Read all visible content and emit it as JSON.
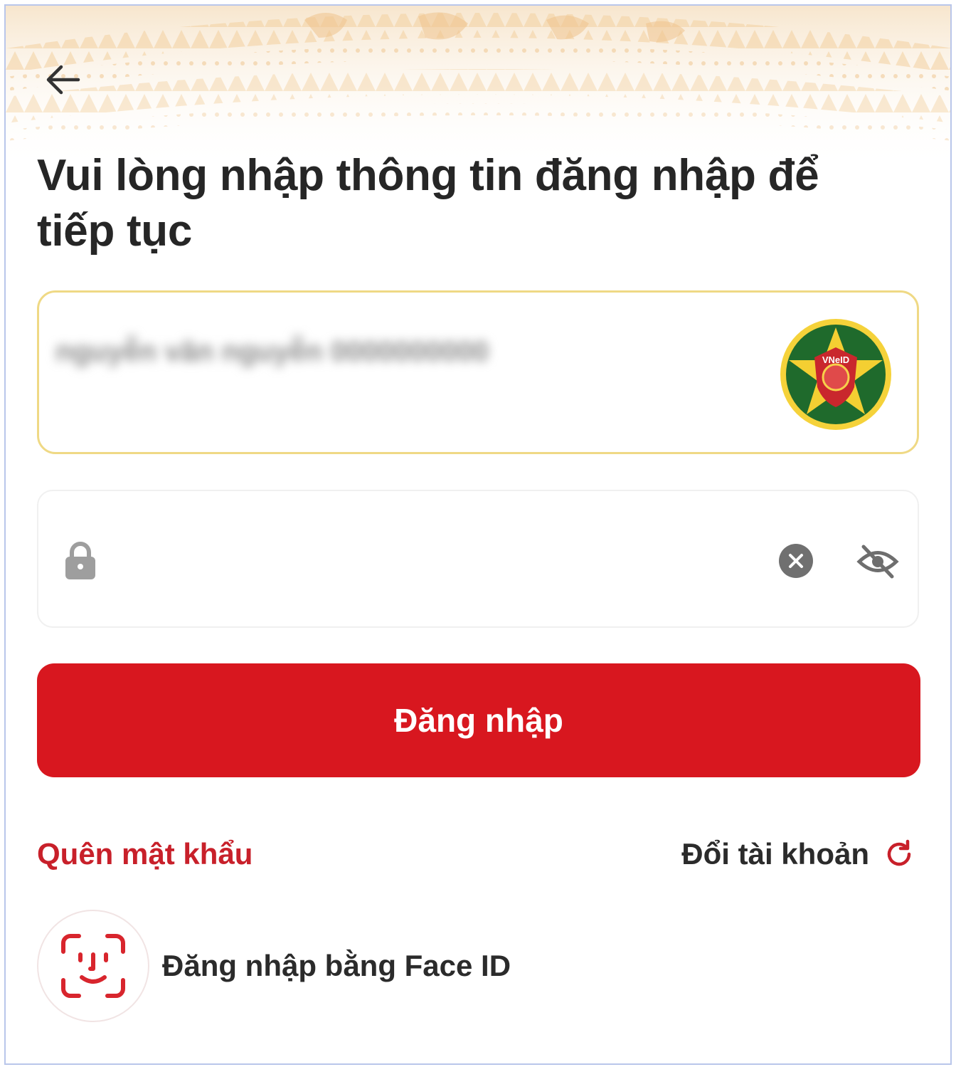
{
  "header": {
    "back_icon": "arrow-left-icon",
    "title": "Vui lòng nhập thông tin đăng nhập để tiếp tục"
  },
  "login_form": {
    "username": {
      "value_obscured": "nguyễn văn nguyễn 0000000000",
      "badge_icon": "vneid-police-badge-icon",
      "badge_text": "VNeID",
      "border_color": "#efd985"
    },
    "password": {
      "value": "",
      "lock_icon": "lock-icon",
      "clear_icon": "clear-circle-icon",
      "visibility_icon": "eye-slash-icon"
    },
    "submit_label": "Đăng nhập",
    "submit_color": "#d8171f"
  },
  "links": {
    "forgot_password": "Quên mật khẩu",
    "switch_account": "Đổi tài khoản",
    "switch_icon": "refresh-icon",
    "accent_color": "#c8202a"
  },
  "faceid": {
    "label": "Đăng nhập bằng Face ID",
    "icon": "face-id-icon"
  }
}
